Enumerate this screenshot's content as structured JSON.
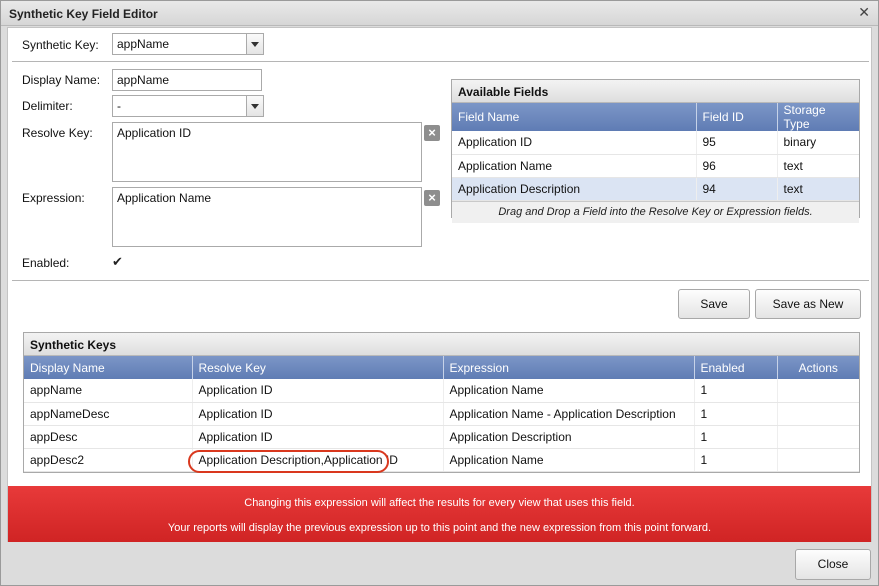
{
  "window": {
    "title": "Synthetic Key Field Editor"
  },
  "form": {
    "synthetic_key_label": "Synthetic Key:",
    "synthetic_key_value": "appName",
    "display_name_label": "Display Name:",
    "display_name_value": "appName",
    "delimiter_label": "Delimiter:",
    "delimiter_value": "-",
    "resolve_key_label": "Resolve Key:",
    "resolve_key_value": "Application ID",
    "expression_label": "Expression:",
    "expression_value": "Application Name",
    "enabled_label": "Enabled:",
    "enabled_checked": true
  },
  "available_fields": {
    "title": "Available Fields",
    "columns": [
      "Field Name",
      "Field ID",
      "Storage Type"
    ],
    "rows": [
      {
        "name": "Application ID",
        "id": "95",
        "type": "binary"
      },
      {
        "name": "Application Name",
        "id": "96",
        "type": "text"
      },
      {
        "name": "Application Description",
        "id": "94",
        "type": "text"
      }
    ],
    "hint": "Drag and Drop a Field into the Resolve Key or Expression fields."
  },
  "buttons": {
    "save": "Save",
    "save_as_new": "Save as New",
    "close": "Close"
  },
  "synthetic_keys": {
    "title": "Synthetic Keys",
    "columns": [
      "Display Name",
      "Resolve Key",
      "Expression",
      "Enabled",
      "Actions"
    ],
    "rows": [
      {
        "display": "appName",
        "resolve": "Application ID",
        "expression": "Application Name",
        "enabled": "1"
      },
      {
        "display": "appNameDesc",
        "resolve": "Application ID",
        "expression": "Application Name - Application Description",
        "enabled": "1"
      },
      {
        "display": "appDesc",
        "resolve": "Application ID",
        "expression": "Application Description",
        "enabled": "1"
      },
      {
        "display": "appDesc2",
        "resolve": "Application Description,Application ID",
        "expression": "Application Name",
        "enabled": "1"
      }
    ]
  },
  "warning": {
    "line1": "Changing this expression will affect the results for every view that uses this field.",
    "line2": "Your reports will display the previous expression up to this point and the new expression from this point forward."
  },
  "colors": {
    "header_blue": "#6b86bd",
    "warning_red": "#dd3030",
    "highlight_ring": "#d9381e"
  }
}
